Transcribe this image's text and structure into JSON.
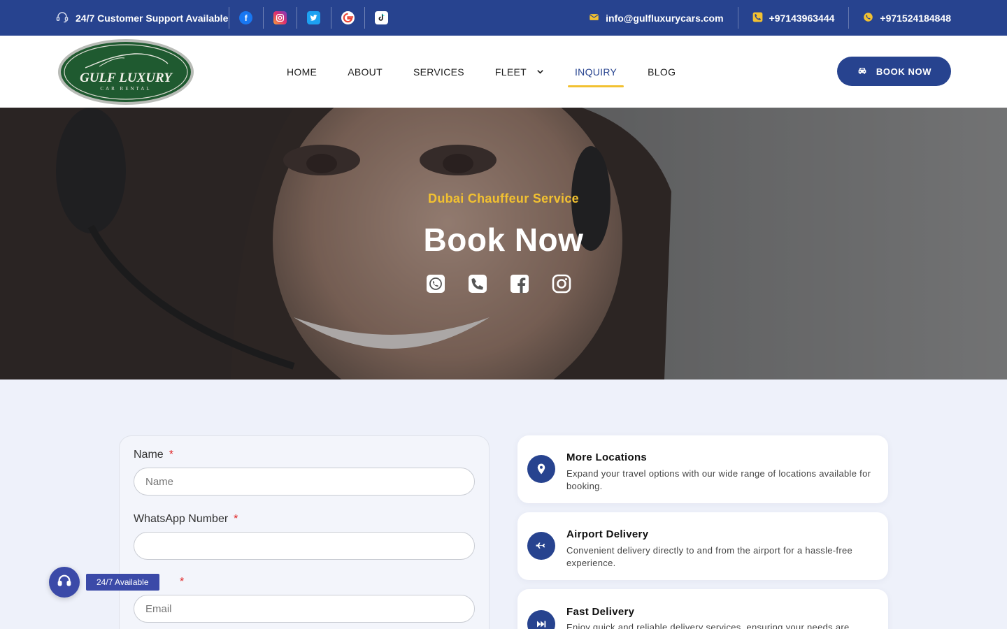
{
  "topbar": {
    "support_text": "24/7 Customer Support Available",
    "social_icons": [
      "facebook-icon",
      "instagram-icon",
      "twitter-icon",
      "google-icon",
      "tiktok-icon"
    ],
    "email": "info@gulfluxurycars.com",
    "phone": "+97143963444",
    "whatsapp": "+971524184848"
  },
  "header": {
    "logo_text": "GULF LUXURY",
    "logo_subtext": "CAR RENTAL",
    "nav": [
      "HOME",
      "ABOUT",
      "SERVICES",
      "FLEET",
      "INQUIRY",
      "BLOG"
    ],
    "active_nav": "INQUIRY",
    "book_button": "BOOK NOW"
  },
  "hero": {
    "subtitle": "Dubai Chauffeur Service",
    "title": "Book Now",
    "icons": [
      "whatsapp-icon",
      "phone-icon",
      "facebook-icon",
      "instagram-icon"
    ]
  },
  "form": {
    "name_label": "Name",
    "name_placeholder": "Name",
    "whatsapp_label": "WhatsApp Number",
    "whatsapp_placeholder": "",
    "email_label": "",
    "email_placeholder": "Email",
    "required_mark": "*"
  },
  "features": [
    {
      "title": "More Locations",
      "desc": "Expand your travel options with our wide range of locations available for booking.",
      "icon": "location-pin-icon"
    },
    {
      "title": "Airport Delivery",
      "desc": "Convenient delivery directly to and from the airport for a hassle-free experience.",
      "icon": "airplane-icon"
    },
    {
      "title": "Fast Delivery",
      "desc": "Enjoy quick and reliable delivery services, ensuring your needs are",
      "icon": "fast-forward-icon"
    }
  ],
  "floating": {
    "label": "24/7 Available"
  },
  "colors": {
    "brand_blue": "#27438f",
    "accent_yellow": "#f2c131",
    "page_bg": "#eef1fa"
  }
}
